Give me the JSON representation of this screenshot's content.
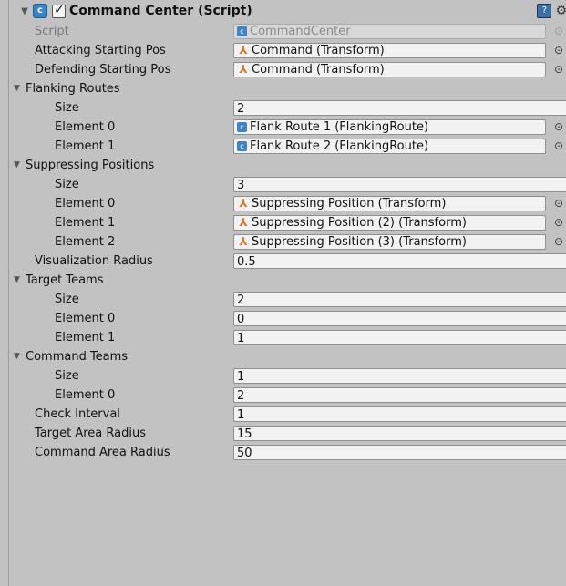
{
  "header": {
    "title": "Command Center (Script)",
    "foldout_icon": "▼",
    "script_icon": "C#",
    "help_icon": "?",
    "gear_icon": "⚙"
  },
  "fields": {
    "script": {
      "label": "Script",
      "value": "CommandCenter"
    },
    "attacking_start": {
      "label": "Attacking Starting Pos",
      "value": "Command (Transform)"
    },
    "defending_start": {
      "label": "Defending Starting Pos",
      "value": "Command (Transform)"
    },
    "flanking_routes": {
      "label": "Flanking Routes",
      "size_label": "Size",
      "size": "2",
      "elements": [
        {
          "label": "Element 0",
          "value": "Flank Route 1 (FlankingRoute)"
        },
        {
          "label": "Element 1",
          "value": "Flank Route 2 (FlankingRoute)"
        }
      ]
    },
    "suppressing_positions": {
      "label": "Suppressing Positions",
      "size_label": "Size",
      "size": "3",
      "elements": [
        {
          "label": "Element 0",
          "value": "Suppressing Position (Transform)"
        },
        {
          "label": "Element 1",
          "value": "Suppressing Position (2) (Transform)"
        },
        {
          "label": "Element 2",
          "value": "Suppressing Position (3) (Transform)"
        }
      ]
    },
    "visualization_radius": {
      "label": "Visualization Radius",
      "value": "0.5"
    },
    "target_teams": {
      "label": "Target Teams",
      "size_label": "Size",
      "size": "2",
      "elements": [
        {
          "label": "Element 0",
          "value": "0"
        },
        {
          "label": "Element 1",
          "value": "1"
        }
      ]
    },
    "command_teams": {
      "label": "Command Teams",
      "size_label": "Size",
      "size": "1",
      "elements": [
        {
          "label": "Element 0",
          "value": "2"
        }
      ]
    },
    "check_interval": {
      "label": "Check Interval",
      "value": "1"
    },
    "target_area_radius": {
      "label": "Target Area Radius",
      "value": "15"
    },
    "command_area_radius": {
      "label": "Command Area Radius",
      "value": "50"
    }
  },
  "icons": {
    "transform": "⅄",
    "picker": "⊙",
    "fold": "▼"
  }
}
